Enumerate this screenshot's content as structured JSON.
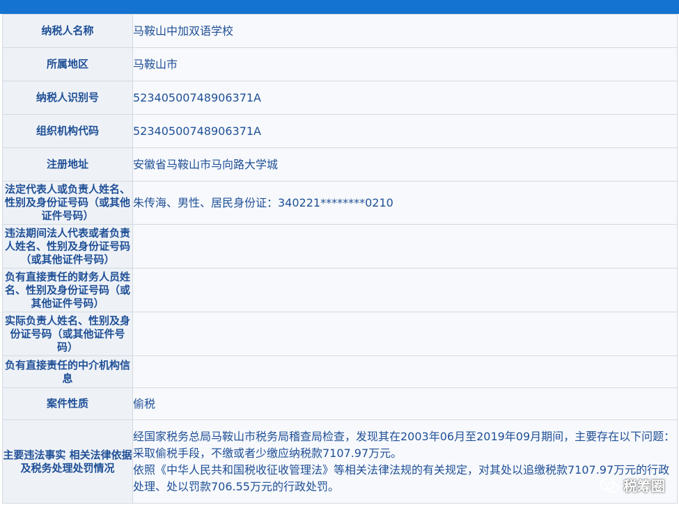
{
  "rows": [
    {
      "label": "纳税人名称",
      "value": "马鞍山中加双语学校"
    },
    {
      "label": "所属地区",
      "value": "马鞍山市"
    },
    {
      "label": "纳税人识别号",
      "value": "52340500748906371A"
    },
    {
      "label": "组织机构代码",
      "value": "52340500748906371A"
    },
    {
      "label": "注册地址",
      "value": "安徽省马鞍山市马向路大学城"
    },
    {
      "label": "法定代表人或负责人姓名、性别及身份证号码（或其他证件号码）",
      "value": "朱传海、男性、居民身份证：340221********0210"
    },
    {
      "label": "违法期间法人代表或者负责人姓名、性别及身份证号码（或其他证件号码）",
      "value": ""
    },
    {
      "label": "负有直接责任的财务人员姓名、性别及身份证号码（或其他证件号码）",
      "value": ""
    },
    {
      "label": "实际负责人姓名、性别及身份证号码（或其他证件号码）",
      "value": ""
    },
    {
      "label": "负有直接责任的中介机构信息",
      "value": ""
    },
    {
      "label": "案件性质",
      "value": "偷税"
    },
    {
      "label": "主要违法事实 相关法律依据及税务处理处罚情况",
      "value_para1": "经国家税务总局马鞍山市税务局稽查局检查，发现其在2003年06月至2019年09月期间，主要存在以下问题：采取偷税手段，不缴或者少缴应纳税款7107.97万元。",
      "value_para2": "依照《中华人民共和国税收征收管理法》等相关法律法规的有关规定，对其处以追缴税款7107.97万元的行政处理、处以罚款706.55万元的行政处罚。"
    }
  ],
  "watermark": {
    "text": "税筹圈",
    "icon": "wechat-icon"
  }
}
